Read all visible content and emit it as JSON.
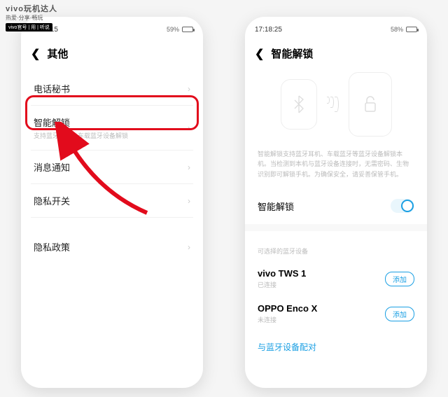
{
  "watermark": {
    "brand": "vivo玩机达人",
    "sub": "热爱·分享·畅玩",
    "badge": "vivo官号 | 用 | 听说"
  },
  "left": {
    "status": {
      "time": "17:17:15",
      "signal": "●●●● 📶 📊 59%",
      "battery_pct": 59
    },
    "title": "其他",
    "items": [
      {
        "label": "电话秘书",
        "sub": ""
      },
      {
        "label": "智能解锁",
        "sub": "支持蓝牙耳机、车载蓝牙设备解锁"
      },
      {
        "label": "消息通知",
        "sub": ""
      },
      {
        "label": "隐私开关",
        "sub": ""
      },
      {
        "label": "隐私政策",
        "sub": ""
      }
    ]
  },
  "right": {
    "status": {
      "time": "17:18:25",
      "signal": "🔵 ●●● 📶 📊 58%",
      "battery_pct": 58
    },
    "title": "智能解锁",
    "description": "智能解锁支持蓝牙耳机、车载蓝牙等蓝牙设备解锁本机。当检测到本机与蓝牙设备连接时，无需密码、生物识别即可解锁手机。为确保安全，请妥善保管手机。",
    "toggle_label": "智能解锁",
    "toggle_on": true,
    "devices_header": "可选择的蓝牙设备",
    "devices": [
      {
        "name": "vivo TWS 1",
        "state": "已连接",
        "action": "添加"
      },
      {
        "name": "OPPO Enco X",
        "state": "未连接",
        "action": "添加"
      }
    ],
    "pair_link": "与蓝牙设备配对"
  }
}
